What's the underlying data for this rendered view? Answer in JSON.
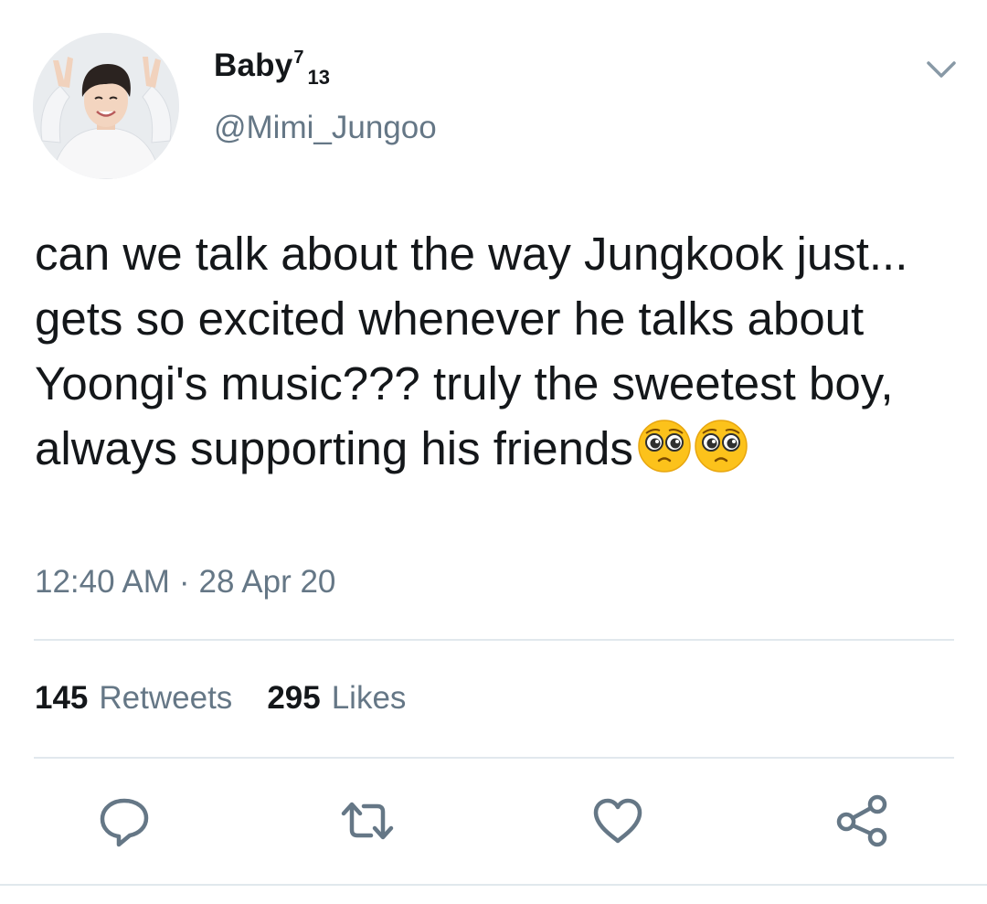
{
  "author": {
    "display_name": "Baby",
    "name_sup": "7",
    "name_sub": "13",
    "handle": "@Mimi_Jungoo"
  },
  "tweet": {
    "text": "can we talk about the way Jungkook just... gets so excited whenever he talks about Yoongi's music??? truly the sweetest boy, always supporting his friends",
    "emojis": [
      "pleading-face",
      "pleading-face"
    ],
    "time": "12:40 AM",
    "separator": "·",
    "date": "28 Apr 20"
  },
  "stats": {
    "retweets_count": "145",
    "retweets_label": "Retweets",
    "likes_count": "295",
    "likes_label": "Likes"
  },
  "actions": {
    "icons": [
      "reply-icon",
      "retweet-icon",
      "like-icon",
      "share-icon"
    ]
  },
  "colors": {
    "text": "#14171a",
    "secondary_text": "#657786",
    "divider": "#e1e8ed",
    "icon": "#657786",
    "emoji": "#fcc21b"
  }
}
